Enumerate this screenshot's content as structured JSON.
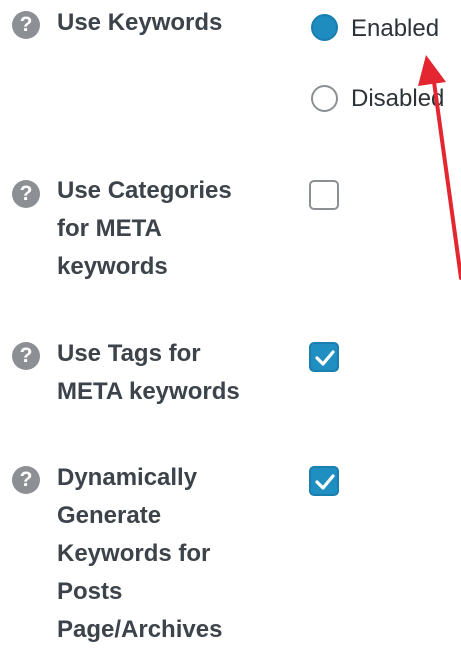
{
  "colors": {
    "help_icon": "#8c8f94",
    "label_text": "#3c434a",
    "accent_blue": "#1e8cbe",
    "annotation_arrow": "#e3262f"
  },
  "icons": {
    "help": "question-circle-icon",
    "check": "checkmark-icon",
    "annotation": "red-arrow-annotation"
  },
  "settings": {
    "use_keywords": {
      "help_glyph": "?",
      "label": "Use Keywords",
      "options": [
        {
          "label": "Enabled",
          "selected": true
        },
        {
          "label": "Disabled",
          "selected": false
        }
      ]
    },
    "use_categories": {
      "help_glyph": "?",
      "label_lines": [
        "Use Categories",
        "for META",
        "keywords"
      ],
      "checked": false
    },
    "use_tags": {
      "help_glyph": "?",
      "label_lines": [
        "Use Tags for",
        "META keywords"
      ],
      "checked": true
    },
    "dynamic_keywords": {
      "help_glyph": "?",
      "label_lines": [
        "Dynamically",
        "Generate",
        "Keywords for",
        "Posts",
        "Page/Archives"
      ],
      "checked": true
    }
  }
}
